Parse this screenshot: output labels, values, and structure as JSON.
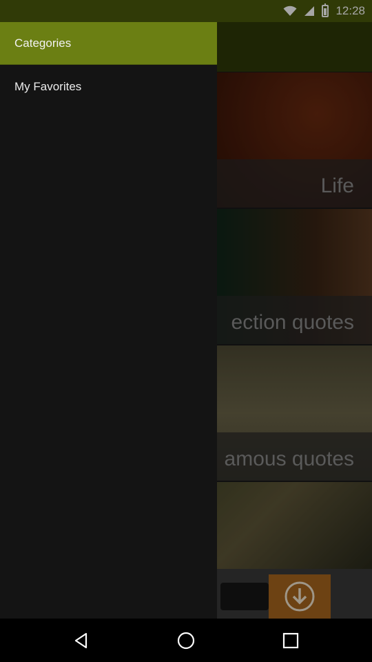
{
  "status_bar": {
    "time": "12:28",
    "icons": [
      "wifi-icon",
      "signal-icon",
      "battery-icon"
    ]
  },
  "drawer": {
    "title": "Categories",
    "items": [
      {
        "label": "My Favorites"
      }
    ]
  },
  "content": {
    "cards": [
      {
        "label": "Life"
      },
      {
        "label": "ection quotes"
      },
      {
        "label": "amous quotes"
      }
    ],
    "banner_icon": "download-arrow-icon"
  },
  "nav_bar": {
    "icons": [
      "back-icon",
      "home-icon",
      "recents-icon"
    ]
  },
  "colors": {
    "drawer_header": "#6b7f13",
    "status_bar": "#4a5a0c",
    "drawer_background": "#141414",
    "download_badge": "#a8661e"
  }
}
